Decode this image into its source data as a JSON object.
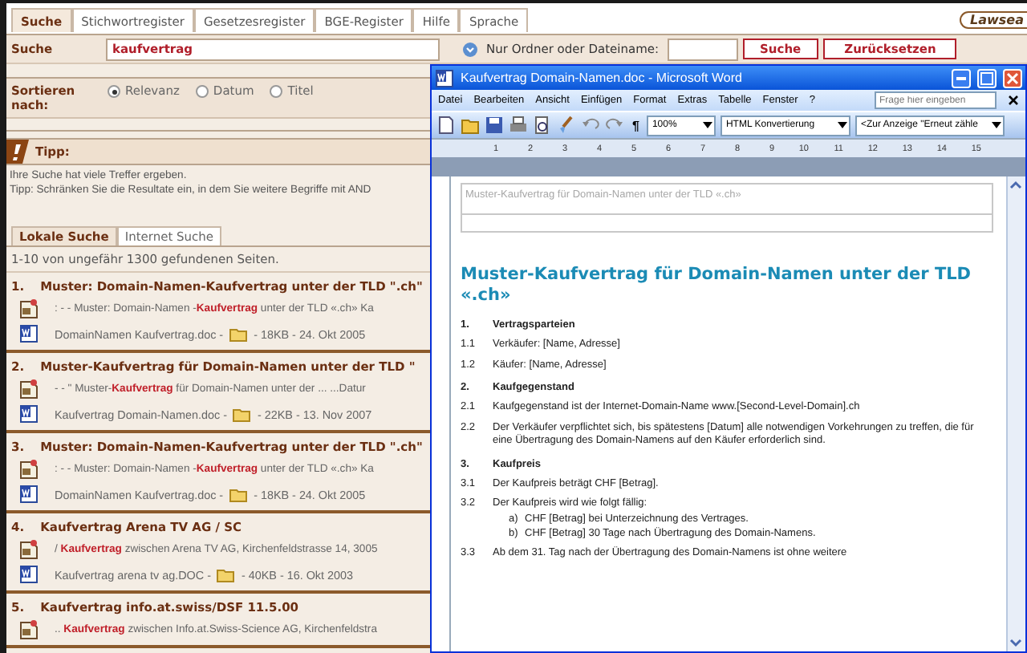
{
  "site": {
    "tabs": [
      {
        "label": "Suche",
        "selected": true
      },
      {
        "label": "Stichwortregister",
        "selected": false
      },
      {
        "label": "Gesetzesregister",
        "selected": false
      },
      {
        "label": "BGE-Register",
        "selected": false
      },
      {
        "label": "Hilfe",
        "selected": false
      },
      {
        "label": "Sprache",
        "selected": false
      }
    ],
    "logo": "Lawsea",
    "search": {
      "label": "Suche",
      "value": "kaufvertrag",
      "option_label": "Nur Ordner oder Dateiname:",
      "buttons": [
        "Suche",
        "Zurücksetzen"
      ]
    },
    "sort": {
      "label": "Sortieren nach:",
      "options": [
        {
          "label": "Relevanz",
          "selected": true
        },
        {
          "label": "Datum",
          "selected": false
        },
        {
          "label": "Titel",
          "selected": false
        }
      ]
    },
    "tip": {
      "title": "Tipp:",
      "lines": [
        "Ihre Suche hat viele Treffer ergeben.",
        "Tipp: Schränken Sie die Resultate ein, in dem Sie weitere Begriffe mit AND"
      ]
    },
    "result_tabs": [
      {
        "label": "Lokale Suche",
        "selected": true
      },
      {
        "label": "Internet Suche",
        "selected": false
      }
    ],
    "result_count": "1-10 von ungefähr 1300 gefundenen Seiten.",
    "results": [
      {
        "number": "1.",
        "title": "Muster: Domain-Namen-Kaufvertrag unter der TLD \".ch\"",
        "snippet": ": - - Muster: Domain-Namen -**Kaufvertrag** unter der TLD «.ch» Ka",
        "file": {
          "name": "DomainNamen Kaufvertrag.doc  -",
          "details": "- 18KB  - 24. Okt 2005"
        }
      },
      {
        "number": "2.",
        "title": "Muster-Kaufvertrag für Domain-Namen unter der TLD \"",
        "snippet": "- - \" Muster-**Kaufvertrag** für Domain-Namen unter der ... ...Datur",
        "file": {
          "name": "Kaufvertrag Domain-Namen.doc  -",
          "details": "- 22KB  - 13. Nov 2007"
        }
      },
      {
        "number": "3.",
        "title": "Muster: Domain-Namen-Kaufvertrag unter der TLD \".ch\"",
        "snippet": ": - - Muster: Domain-Namen -**Kaufvertrag** unter der TLD «.ch» Ka",
        "file": {
          "name": "DomainNamen Kaufvertrag.doc  -",
          "details": "- 18KB  - 24. Okt 2005"
        }
      },
      {
        "number": "4.",
        "title": "Kaufvertrag Arena TV AG / SC",
        "snippet": "/ **Kaufvertrag** zwischen Arena TV AG, Kirchenfeldstrasse 14, 3005",
        "file": {
          "name": "Kaufvertrag arena tv ag.DOC  -",
          "details": "- 40KB  - 16. Okt 2003"
        }
      },
      {
        "number": "5.",
        "title": "Kaufvertrag info.at.swiss/DSF 11.5.00",
        "snippet": ".. **Kaufvertrag** zwischen Info.at.Swiss-Science AG, Kirchenfeldstra"
      }
    ]
  },
  "word": {
    "title": "Kaufvertrag Domain-Namen.doc - Microsoft Word",
    "menu": [
      "Datei",
      "Bearbeiten",
      "Ansicht",
      "Einfügen",
      "Format",
      "Extras",
      "Tabelle",
      "Fenster",
      "?"
    ],
    "help_placeholder": "Frage hier eingeben",
    "toolbar": {
      "pilcrow": "¶",
      "zoom": "100%",
      "style": "HTML Konvertierung",
      "field": "<Zur Anzeige \"Erneut zähle"
    },
    "ruler_labels": [
      "1",
      "2",
      "3",
      "4",
      "5",
      "6",
      "7",
      "8",
      "9",
      "10",
      "11",
      "12",
      "13",
      "14",
      "15"
    ],
    "document": {
      "header_text": "Muster-Kaufvertrag für Domain-Namen unter der TLD «.ch»",
      "heading": "Muster-Kaufvertrag für Domain-Namen unter der TLD «.ch»",
      "sections": [
        {
          "number": "1.",
          "title": "Vertragsparteien",
          "clauses": [
            {
              "number": "1.1",
              "text": "Verkäufer: [Name, Adresse]"
            },
            {
              "number": "1.2",
              "text": "Käufer: [Name, Adresse]"
            }
          ]
        },
        {
          "number": "2.",
          "title": "Kaufgegenstand",
          "clauses": [
            {
              "number": "2.1",
              "text": "Kaufgegenstand ist der Internet-Domain-Name www.[Second-Level-Domain].ch"
            },
            {
              "number": "2.2",
              "text": "Der Verkäufer verpflichtet sich, bis spätestens [Datum] alle notwendigen Vorkehrungen zu treffen, die für eine Übertragung des Domain-Namens auf den Käufer erforderlich sind."
            }
          ]
        },
        {
          "number": "3.",
          "title": "Kaufpreis",
          "clauses": [
            {
              "number": "3.1",
              "text": "Der Kaufpreis beträgt CHF [Betrag]."
            },
            {
              "number": "3.2",
              "text": "Der Kaufpreis wird wie folgt fällig:",
              "items": [
                {
                  "marker": "a)",
                  "text": "CHF [Betrag] bei Unterzeichnung des Vertrages."
                },
                {
                  "marker": "b)",
                  "text": "CHF [Betrag] 30 Tage nach Übertragung des Domain-Namens."
                }
              ]
            },
            {
              "number": "3.3",
              "text": "Ab dem 31. Tag nach der Übertragung des Domain-Namens ist ohne weitere"
            }
          ]
        }
      ]
    }
  }
}
